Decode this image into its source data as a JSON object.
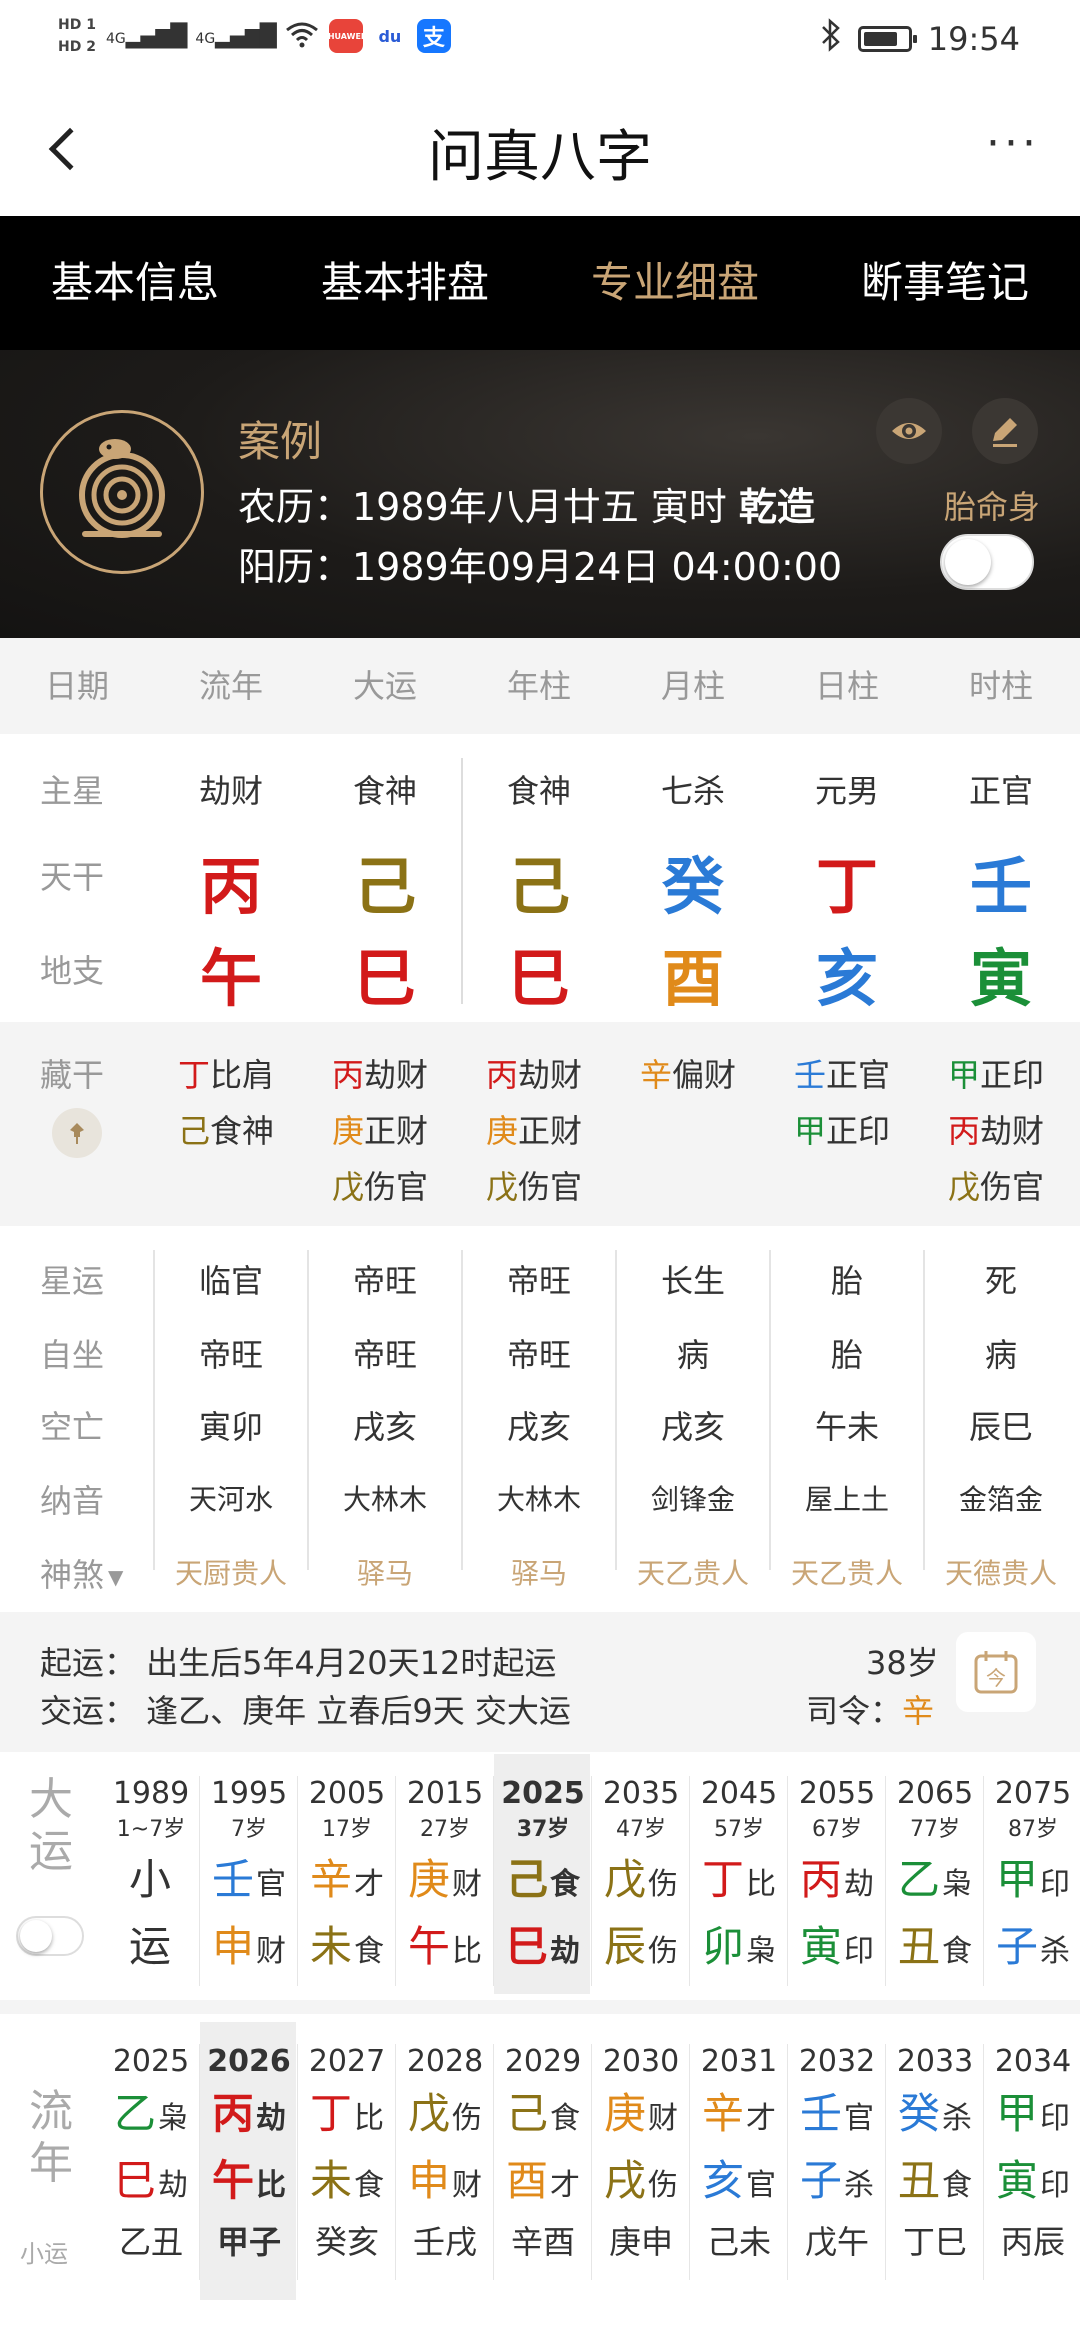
{
  "statusbar": {
    "hd1": "HD 1",
    "hd2": "HD 2",
    "sig1": "4G",
    "sig2": "4G",
    "app1": "HUAWEI",
    "app2": "du",
    "app3": "支",
    "time": "19:54",
    "battery_level": 0.8
  },
  "titlebar": {
    "title": "问真八字",
    "more": "···"
  },
  "tabs": [
    "基本信息",
    "基本排盘",
    "专业细盘",
    "断事笔记"
  ],
  "profile": {
    "name": "案例",
    "lunar_prefix": "农历：1989年八月廿五 寅时 ",
    "lunar_bold": "乾造",
    "solar": "阳历：1989年09月24日 04:00:00",
    "taimingshen_label": "胎命身"
  },
  "grid": {
    "headers": [
      "日期",
      "流年",
      "大运",
      "年柱",
      "月柱",
      "日柱",
      "时柱"
    ],
    "row_labels": {
      "zhuxing": "主星",
      "tiangan": "天干",
      "dizhi": "地支",
      "canggan": "藏干",
      "xingyun": "星运",
      "zizuo": "自坐",
      "kongwang": "空亡",
      "nayin": "纳音",
      "shensha": "神煞"
    },
    "zhuxing": [
      "劫财",
      "食神",
      "食神",
      "七杀",
      "元男",
      "正官"
    ],
    "tiangan": [
      "丙",
      "己",
      "己",
      "癸",
      "丁",
      "壬"
    ],
    "dizhi": [
      "午",
      "巳",
      "巳",
      "酉",
      "亥",
      "寅"
    ],
    "canggan": [
      [
        {
          "g": "丁",
          "s": "比肩"
        },
        {
          "g": "己",
          "s": "食神"
        }
      ],
      [
        {
          "g": "丙",
          "s": "劫财"
        },
        {
          "g": "庚",
          "s": "正财"
        },
        {
          "g": "戊",
          "s": "伤官"
        }
      ],
      [
        {
          "g": "丙",
          "s": "劫财"
        },
        {
          "g": "庚",
          "s": "正财"
        },
        {
          "g": "戊",
          "s": "伤官"
        }
      ],
      [
        {
          "g": "辛",
          "s": "偏财"
        }
      ],
      [
        {
          "g": "壬",
          "s": "正官"
        },
        {
          "g": "甲",
          "s": "正印"
        }
      ],
      [
        {
          "g": "甲",
          "s": "正印"
        },
        {
          "g": "丙",
          "s": "劫财"
        },
        {
          "g": "戊",
          "s": "伤官"
        }
      ]
    ],
    "xingyun": [
      "临官",
      "帝旺",
      "帝旺",
      "长生",
      "胎",
      "死"
    ],
    "zizuo": [
      "帝旺",
      "帝旺",
      "帝旺",
      "病",
      "胎",
      "病"
    ],
    "kongwang": [
      "寅卯",
      "戌亥",
      "戌亥",
      "戌亥",
      "午未",
      "辰巳"
    ],
    "nayin": [
      "天河水",
      "大林木",
      "大林木",
      "剑锋金",
      "屋上土",
      "金箔金"
    ],
    "shensha": [
      "天厨贵人",
      "驿马",
      "驿马",
      "天乙贵人",
      "天乙贵人",
      "天德贵人"
    ]
  },
  "qiyun": {
    "line1": "起运：  出生后5年4月20天12时起运",
    "line2": "交运：  逢乙、庚年 立春后9天 交大运",
    "age": "38岁",
    "siling_label": "司令：",
    "siling_value": "辛"
  },
  "dayun": {
    "label": "大运",
    "cols": [
      {
        "year": "1989",
        "age": "1~7岁",
        "g": "小",
        "gs": "",
        "z": "运",
        "zs": ""
      },
      {
        "year": "1995",
        "age": "7岁",
        "g": "壬",
        "gs": "官",
        "z": "申",
        "zs": "财"
      },
      {
        "year": "2005",
        "age": "17岁",
        "g": "辛",
        "gs": "才",
        "z": "未",
        "zs": "食"
      },
      {
        "year": "2015",
        "age": "27岁",
        "g": "庚",
        "gs": "财",
        "z": "午",
        "zs": "比"
      },
      {
        "year": "2025",
        "age": "37岁",
        "g": "己",
        "gs": "食",
        "z": "巳",
        "zs": "劫"
      },
      {
        "year": "2035",
        "age": "47岁",
        "g": "戊",
        "gs": "伤",
        "z": "辰",
        "zs": "伤"
      },
      {
        "year": "2045",
        "age": "57岁",
        "g": "丁",
        "gs": "比",
        "z": "卯",
        "zs": "枭"
      },
      {
        "year": "2055",
        "age": "67岁",
        "g": "丙",
        "gs": "劫",
        "z": "寅",
        "zs": "印"
      },
      {
        "year": "2065",
        "age": "77岁",
        "g": "乙",
        "gs": "枭",
        "z": "丑",
        "zs": "食"
      },
      {
        "year": "2075",
        "age": "87岁",
        "g": "甲",
        "gs": "印",
        "z": "子",
        "zs": "杀"
      }
    ]
  },
  "liunian": {
    "label": "流年",
    "sub": "小运",
    "cols": [
      {
        "year": "2025",
        "g": "乙",
        "gs": "枭",
        "z": "巳",
        "zs": "劫",
        "xy": "乙丑"
      },
      {
        "year": "2026",
        "g": "丙",
        "gs": "劫",
        "z": "午",
        "zs": "比",
        "xy": "甲子"
      },
      {
        "year": "2027",
        "g": "丁",
        "gs": "比",
        "z": "未",
        "zs": "食",
        "xy": "癸亥"
      },
      {
        "year": "2028",
        "g": "戊",
        "gs": "伤",
        "z": "申",
        "zs": "财",
        "xy": "壬戌"
      },
      {
        "year": "2029",
        "g": "己",
        "gs": "食",
        "z": "酉",
        "zs": "才",
        "xy": "辛酉"
      },
      {
        "year": "2030",
        "g": "庚",
        "gs": "财",
        "z": "戌",
        "zs": "伤",
        "xy": "庚申"
      },
      {
        "year": "2031",
        "g": "辛",
        "gs": "才",
        "z": "亥",
        "zs": "官",
        "xy": "己未"
      },
      {
        "year": "2032",
        "g": "壬",
        "gs": "官",
        "z": "子",
        "zs": "杀",
        "xy": "戊午"
      },
      {
        "year": "2033",
        "g": "癸",
        "gs": "杀",
        "z": "丑",
        "zs": "食",
        "xy": "丁巳"
      },
      {
        "year": "2034",
        "g": "甲",
        "gs": "印",
        "z": "寅",
        "zs": "印",
        "xy": "丙辰"
      }
    ]
  },
  "colors": {
    "gold": "#c9a576",
    "red": "#d21a1a",
    "olive": "#8b7216",
    "blue": "#2a7ad6",
    "orange": "#e08a1a",
    "green": "#1b8f38"
  }
}
